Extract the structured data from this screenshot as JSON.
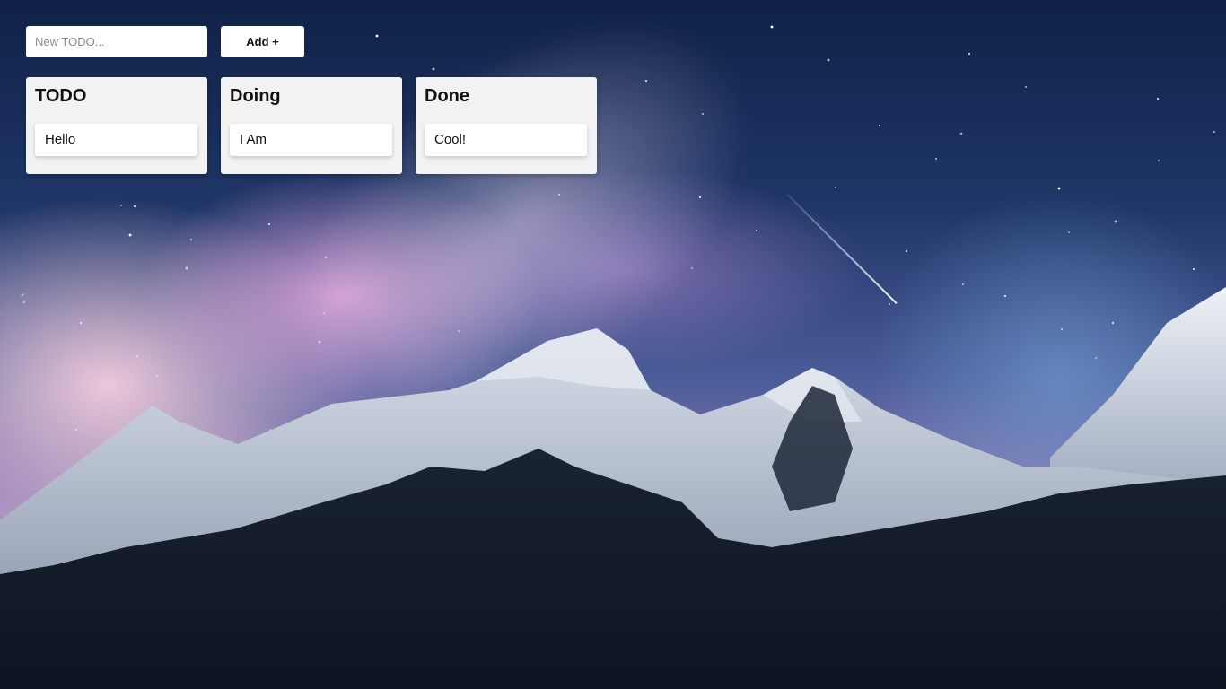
{
  "input": {
    "placeholder": "New TODO...",
    "value": ""
  },
  "add_button": {
    "label": "Add +"
  },
  "columns": [
    {
      "title": "TODO",
      "cards": [
        "Hello"
      ]
    },
    {
      "title": "Doing",
      "cards": [
        "I Am"
      ]
    },
    {
      "title": "Done",
      "cards": [
        "Cool!"
      ]
    }
  ],
  "colors": {
    "column_bg": "#f2f2f2",
    "card_bg": "#ffffff",
    "text": "#111111"
  }
}
